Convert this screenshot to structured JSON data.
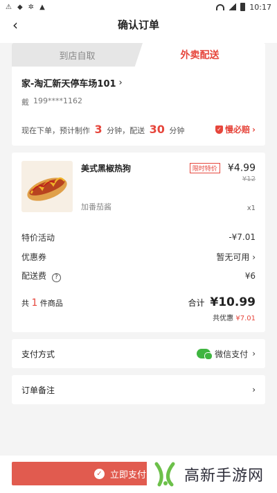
{
  "status_bar": {
    "time": "10:17"
  },
  "nav": {
    "title": "确认订单"
  },
  "tabs": {
    "pickup": "到店自取",
    "delivery": "外卖配送"
  },
  "address": {
    "line": "家-淘汇新天停车场101",
    "name": "戴",
    "phone": "199****1162"
  },
  "timing": {
    "prefix": "现在下单，预计制作",
    "make_minutes": "3",
    "unit1": "分钟，配送",
    "deliver_minutes": "30",
    "unit2": "分钟",
    "late_label": "慢必赔"
  },
  "item": {
    "name": "美式黑椒热狗",
    "option": "加番茄酱",
    "qty": "x1",
    "badge": "限时特价",
    "price": "¥4.99",
    "old_price": "¥12"
  },
  "fees": [
    {
      "label": "特价活动",
      "value": "-¥7.01"
    },
    {
      "label": "优惠券",
      "value": "暂无可用"
    },
    {
      "label": "配送费",
      "value": "¥6"
    }
  ],
  "summary": {
    "count_prefix": "共",
    "count": "1",
    "count_suffix": "件商品",
    "total_label": "合计",
    "total": "¥10.99",
    "saved_label": "共优惠",
    "saved": "¥7.01"
  },
  "payment": {
    "label": "支付方式",
    "method": "微信支付"
  },
  "note": {
    "label": "订单备注"
  },
  "bottom": {
    "pay_label": "立即支付"
  },
  "watermark": {
    "text": "高新手游网"
  },
  "colors": {
    "accent": "#e6463c",
    "wechat": "#3fb540"
  }
}
